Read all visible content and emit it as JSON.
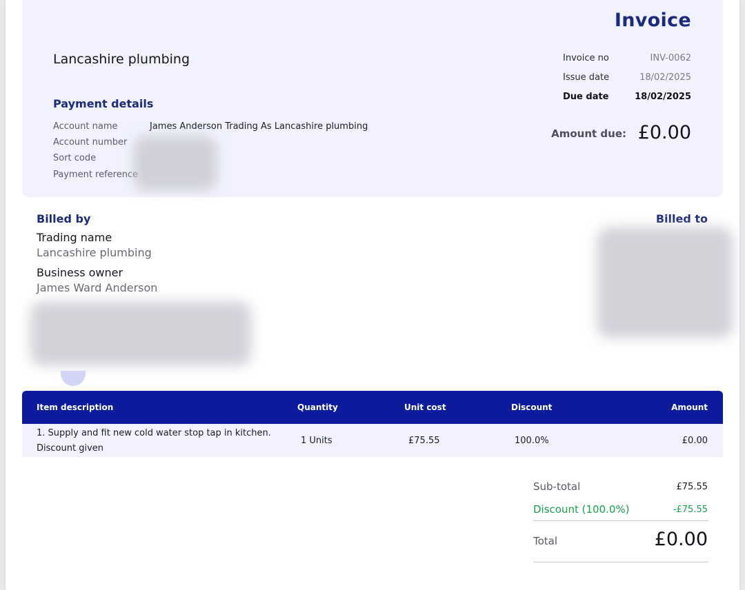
{
  "invoice": {
    "title": "Invoice",
    "company_name": "Lancashire plumbing",
    "meta": {
      "invoice_no_label": "Invoice no",
      "invoice_no": "INV-0062",
      "issue_date_label": "Issue date",
      "issue_date": "18/02/2025",
      "due_date_label": "Due date",
      "due_date": "18/02/2025"
    },
    "amount_due_label": "Amount due:",
    "amount_due": "£0.00"
  },
  "payment": {
    "heading": "Payment details",
    "account_name_label": "Account name",
    "account_name": "James Anderson Trading As Lancashire plumbing",
    "account_number_label": "Account number",
    "sort_code_label": "Sort code",
    "payment_reference_label": "Payment reference"
  },
  "billed_by": {
    "heading": "Billed by",
    "trading_name_label": "Trading name",
    "trading_name": "Lancashire plumbing",
    "owner_label": "Business owner",
    "owner": "James Ward Anderson"
  },
  "billed_to": {
    "heading": "Billed to"
  },
  "table": {
    "headers": {
      "description": "Item description",
      "quantity": "Quantity",
      "unit_cost": "Unit cost",
      "discount": "Discount",
      "amount": "Amount"
    },
    "rows": [
      {
        "description_line1": "1. Supply and fit new cold water stop tap in kitchen.",
        "description_line2": "Discount given",
        "quantity": "1 Units",
        "unit_cost": "£75.55",
        "discount": "100.0%",
        "amount": "£0.00"
      }
    ]
  },
  "totals": {
    "subtotal_label": "Sub-total",
    "subtotal": "£75.55",
    "discount_label": "Discount (100.0%)",
    "discount": "-£75.55",
    "total_label": "Total",
    "total": "£0.00"
  },
  "colors": {
    "brand": "#1b2a7a",
    "table_header": "#0c1b9c",
    "panel": "#f1f2fd",
    "discount": "#17a34a"
  }
}
